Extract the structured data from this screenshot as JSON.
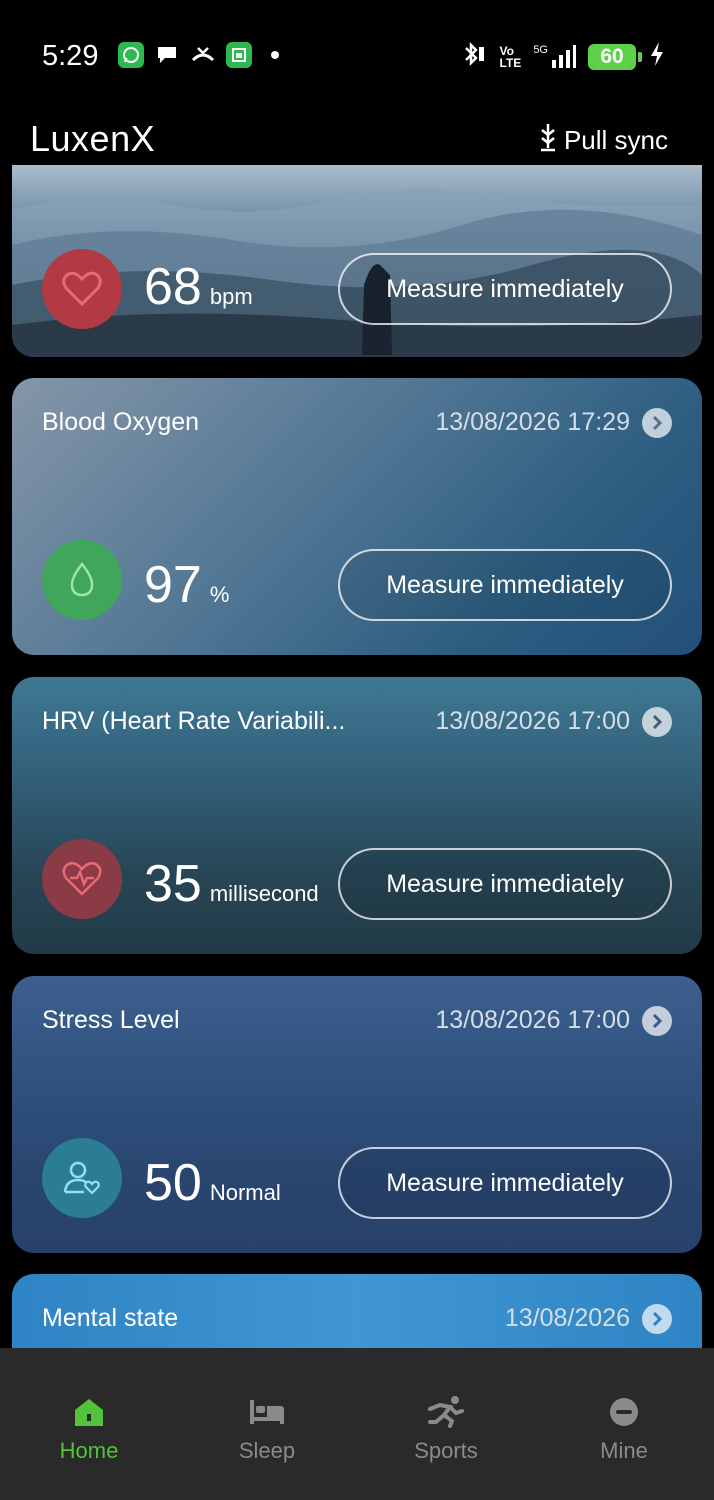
{
  "status": {
    "time": "5:29",
    "battery": "60",
    "left_icons": [
      "whatsapp-icon",
      "chat-bubble-icon",
      "missed-call-icon",
      "calendar-icon",
      "dot-icon"
    ],
    "right_icons": [
      "bluetooth-icon",
      "volte-icon",
      "5g-signal-icon",
      "battery-icon",
      "charging-icon"
    ],
    "volte_top": "Vo",
    "volte_bottom": "LTE",
    "net": "5G"
  },
  "appbar": {
    "title": "LuxenX",
    "sync_label": "Pull sync"
  },
  "cards": {
    "heart": {
      "value": "68",
      "unit": "bpm",
      "button": "Measure immediately"
    },
    "oxygen": {
      "title": "Blood Oxygen",
      "date": "13/08/2026 17:29",
      "value": "97",
      "unit": "%",
      "button": "Measure immediately"
    },
    "hrv": {
      "title": "HRV (Heart Rate Variabili...",
      "date": "13/08/2026 17:00",
      "value": "35",
      "unit": "millisecond",
      "button": "Measure immediately"
    },
    "stress": {
      "title": "Stress Level",
      "date": "13/08/2026 17:00",
      "value": "50",
      "unit": "Normal",
      "button": "Measure immediately"
    },
    "mental": {
      "title": "Mental state",
      "date": "13/08/2026"
    }
  },
  "nav": {
    "home": "Home",
    "sleep": "Sleep",
    "sports": "Sports",
    "mine": "Mine",
    "active": "Home"
  },
  "colors": {
    "accent": "#52c33a",
    "battery": "#5fd04a",
    "heart_icon_bg": "#b23a44",
    "oxygen_icon_bg": "#3fa65a",
    "hrv_icon_bg": "#8a3b45",
    "stress_icon_bg": "#2a7d94"
  }
}
